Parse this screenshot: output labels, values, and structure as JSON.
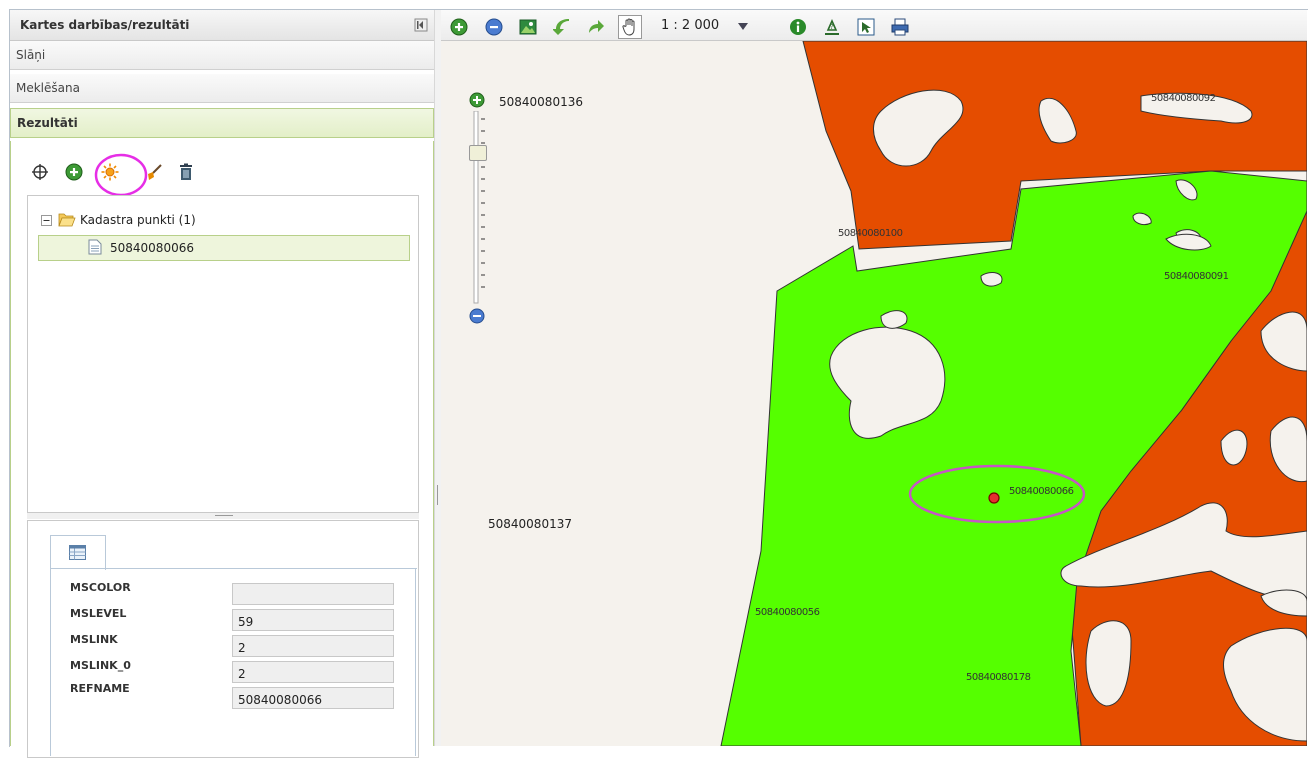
{
  "panel": {
    "title": "Kartes darbības/rezultāti"
  },
  "accordion": {
    "layers": "Slāņi",
    "search": "Meklēšana",
    "results": "Rezultāti"
  },
  "tree": {
    "folder": "Kadastra punkti (1)",
    "item": "50840080066"
  },
  "properties": [
    {
      "label": "MSCOLOR",
      "value": ""
    },
    {
      "label": "MSLEVEL",
      "value": "59"
    },
    {
      "label": "MSLINK",
      "value": "2"
    },
    {
      "label": "MSLINK_0",
      "value": "2"
    },
    {
      "label": "REFNAME",
      "value": "50840080066"
    }
  ],
  "map_toolbar": {
    "scale": "1 : 2 000"
  },
  "map_labels": {
    "p136": "50840080136",
    "p137": "50840080137",
    "p066": "50840080066",
    "p056": "50840080056",
    "p178": "50840080178",
    "p_top_right": "50840080092",
    "p_center": "50840080100",
    "p_right": "50840080091"
  },
  "zoom": {
    "level_fraction": 0.19
  },
  "colors": {
    "green": "#55ff00",
    "orange": "#e54d00",
    "background": "#f5f2ed",
    "highlight": "#c655c6"
  }
}
